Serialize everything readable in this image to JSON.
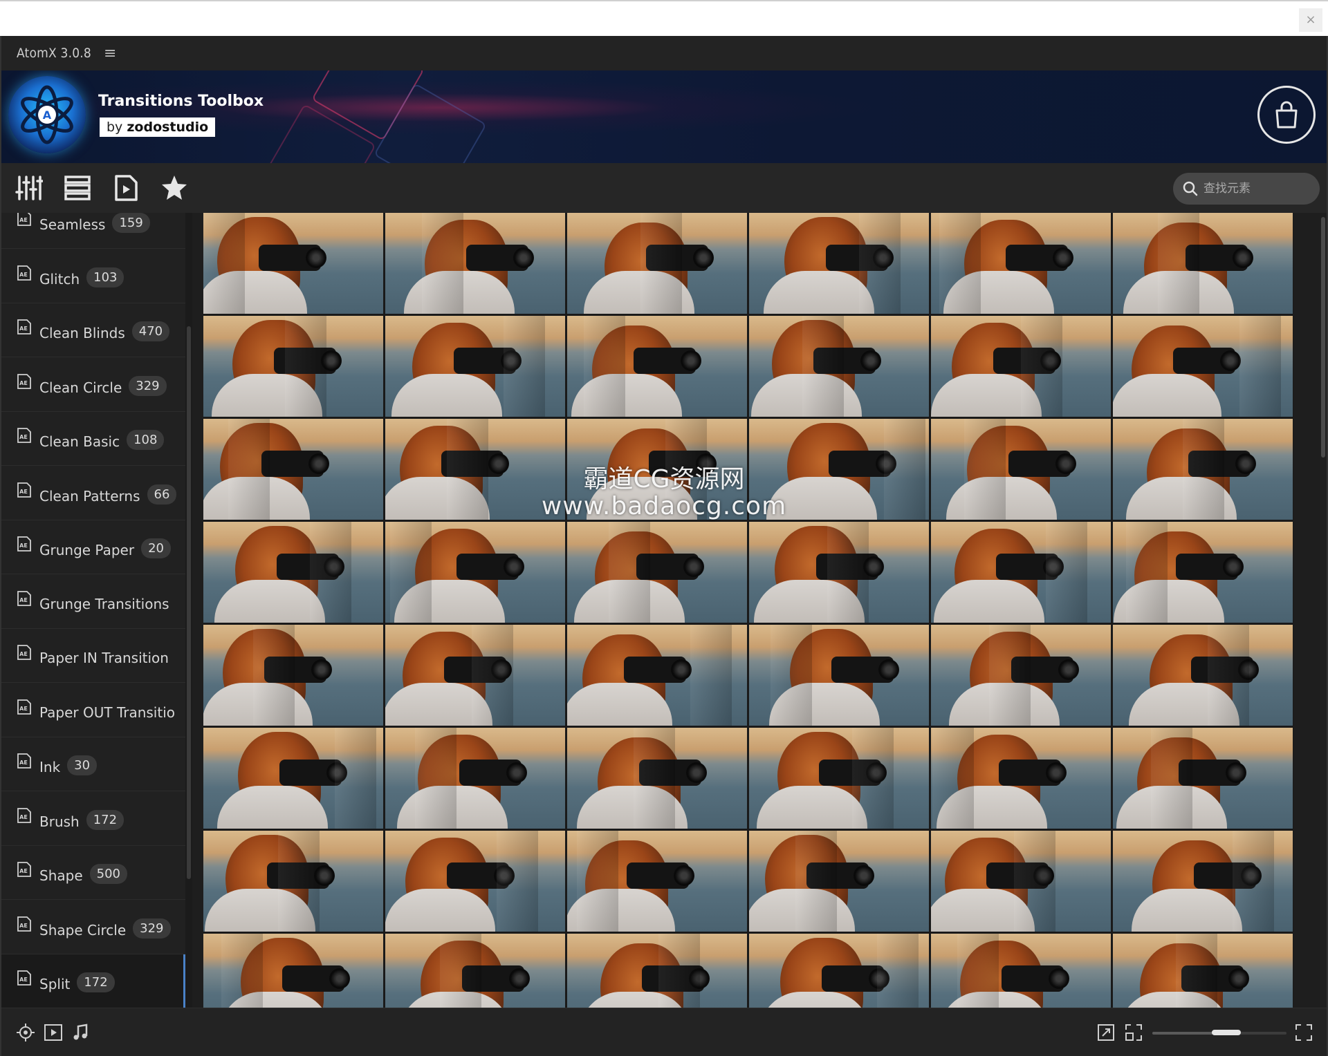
{
  "titlebar": {
    "app_title": "AtomX 3.0.8",
    "menu_icon": "hamburger-icon"
  },
  "banner": {
    "title": "Transitions Toolbox",
    "by_prefix": "by",
    "brand": "zodostudio",
    "shop_icon": "shopping-bag-icon"
  },
  "toolbar": {
    "tools": [
      "sliders-icon",
      "list-view-icon",
      "video-file-icon",
      "star-icon"
    ],
    "search_placeholder": "查找元素"
  },
  "sidebar": {
    "items": [
      {
        "label": "Seamless",
        "count": "159"
      },
      {
        "label": "Glitch",
        "count": "103"
      },
      {
        "label": "Clean Blinds",
        "count": "470"
      },
      {
        "label": "Clean Circle",
        "count": "329"
      },
      {
        "label": "Clean Basic",
        "count": "108"
      },
      {
        "label": "Clean Patterns",
        "count": "66"
      },
      {
        "label": "Grunge Paper",
        "count": "20"
      },
      {
        "label": "Grunge Transitions",
        "count": ""
      },
      {
        "label": "Paper IN Transition",
        "count": ""
      },
      {
        "label": "Paper OUT Transitio",
        "count": ""
      },
      {
        "label": "Ink",
        "count": "30"
      },
      {
        "label": "Brush",
        "count": "172"
      },
      {
        "label": "Shape",
        "count": "500"
      },
      {
        "label": "Shape Circle",
        "count": "329"
      },
      {
        "label": "Split",
        "count": "172",
        "active": true
      }
    ]
  },
  "watermark": {
    "line1": "霸道CG资源网",
    "line2": "www.badaocg.com"
  },
  "statusbar": {
    "left_icons": [
      "target-icon",
      "video-frame-icon",
      "music-note-icon"
    ],
    "right_icons": [
      "expand-icon",
      "fit-icon",
      "fullscreen-icon"
    ],
    "zoom_fraction": 0.55
  },
  "colors": {
    "accent": "#4a82c8",
    "bg": "#1e1e1e"
  }
}
